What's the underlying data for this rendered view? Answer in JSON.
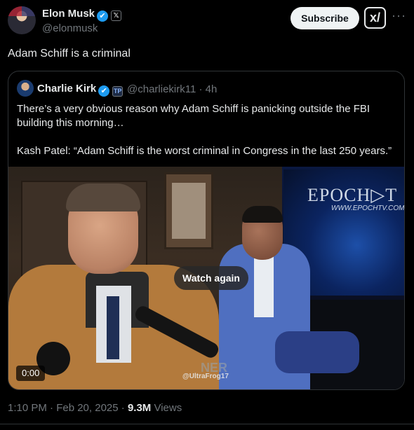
{
  "author": {
    "name": "Elon Musk",
    "handle": "@elonmusk",
    "verified_mark": "✔",
    "affiliate_badge": "𝕏"
  },
  "actions": {
    "subscribe_label": "Subscribe",
    "grok_label": "x/",
    "more_label": "···"
  },
  "tweet": {
    "text": "Adam Schiff is a criminal"
  },
  "quote": {
    "name": "Charlie Kirk",
    "verified_mark": "✔",
    "org_badge": "TP",
    "handle_time": "@charliekirk11 · 4h",
    "paragraph1": "There’s a very obvious reason why Adam Schiff is panicking outside the FBI building this morning…",
    "paragraph2": "Kash Patel: “Adam Schiff is the worst criminal in Congress in the last 250 years.”"
  },
  "video": {
    "watch_again_label": "Watch again",
    "timecode": "0:00",
    "screen_logo": "EPOCH▷T",
    "screen_url": "WWW.EPOCHTV.COM",
    "watermark": "@UltraFrog17",
    "watermark_big": "NER"
  },
  "meta": {
    "time_date": "1:10 PM · Feb 20, 2025 · ",
    "views_count": "9.3M",
    "views_label": " Views"
  },
  "colors": {
    "background": "#000000",
    "text_primary": "#e7e9ea",
    "text_secondary": "#71767b",
    "verified_blue": "#1d9bf0",
    "border": "#2f3336"
  }
}
